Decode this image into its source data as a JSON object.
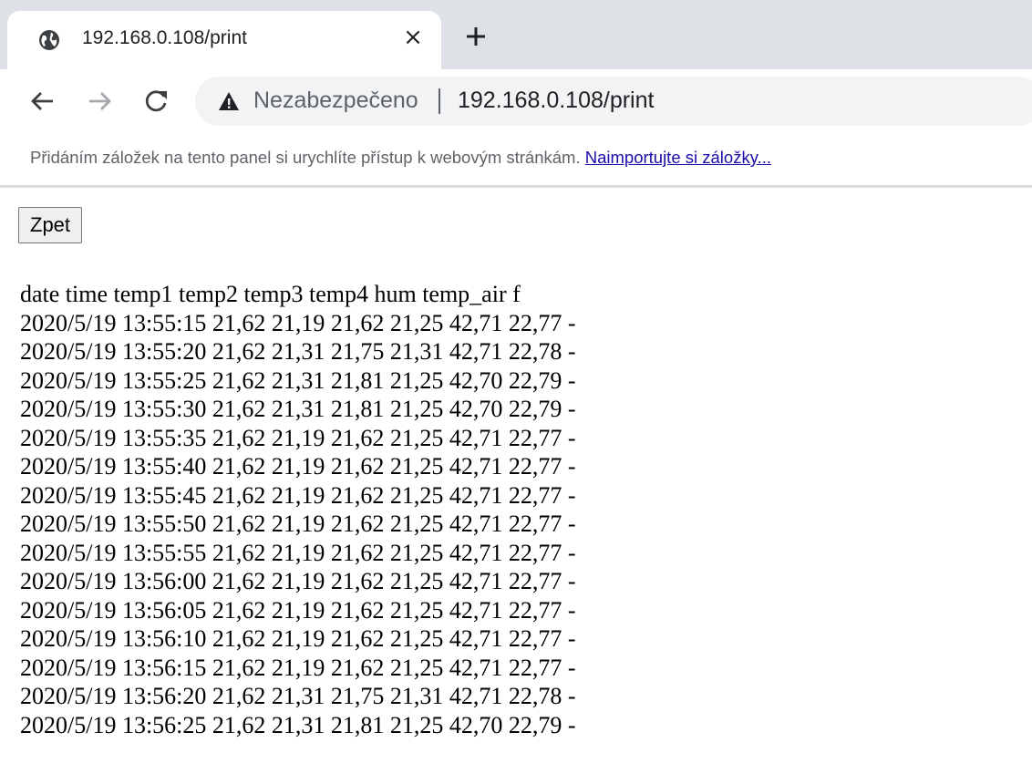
{
  "browser": {
    "tab": {
      "title": "192.168.0.108/print",
      "favicon": "globe-icon",
      "close_icon": "×",
      "new_tab_icon": "plus-icon"
    },
    "toolbar": {
      "back_icon": "arrow-left-icon",
      "forward_icon": "arrow-right-icon",
      "reload_icon": "reload-icon",
      "security_icon": "warning-triangle-icon",
      "security_label": "Nezabezpečeno",
      "url": "192.168.0.108/print"
    },
    "bookmarks_bar": {
      "message": "Přidáním záložek na tento panel si urychlíte přístup k webovým stránkám. ",
      "import_link": "Naimportujte si záložky..."
    }
  },
  "page": {
    "back_button_label": "Zpet",
    "header_line": "date time temp1 temp2 temp3 temp4 hum temp_air f",
    "rows": [
      "2020/5/19 13:55:15 21,62 21,19 21,62 21,25 42,71 22,77 -",
      "2020/5/19 13:55:20 21,62 21,31 21,75 21,31 42,71 22,78 -",
      "2020/5/19 13:55:25 21,62 21,31 21,81 21,25 42,70 22,79 -",
      "2020/5/19 13:55:30 21,62 21,31 21,81 21,25 42,70 22,79 -",
      "2020/5/19 13:55:35 21,62 21,19 21,62 21,25 42,71 22,77 -",
      "2020/5/19 13:55:40 21,62 21,19 21,62 21,25 42,71 22,77 -",
      "2020/5/19 13:55:45 21,62 21,19 21,62 21,25 42,71 22,77 -",
      "2020/5/19 13:55:50 21,62 21,19 21,62 21,25 42,71 22,77 -",
      "2020/5/19 13:55:55 21,62 21,19 21,62 21,25 42,71 22,77 -",
      "2020/5/19 13:56:00 21,62 21,19 21,62 21,25 42,71 22,77 -",
      "2020/5/19 13:56:05 21,62 21,19 21,62 21,25 42,71 22,77 -",
      "2020/5/19 13:56:10 21,62 21,19 21,62 21,25 42,71 22,77 -",
      "2020/5/19 13:56:15 21,62 21,19 21,62 21,25 42,71 22,77 -",
      "2020/5/19 13:56:20 21,62 21,31 21,75 21,31 42,71 22,78 -",
      "2020/5/19 13:56:25 21,62 21,31 21,81 21,25 42,70 22,79 -"
    ]
  }
}
